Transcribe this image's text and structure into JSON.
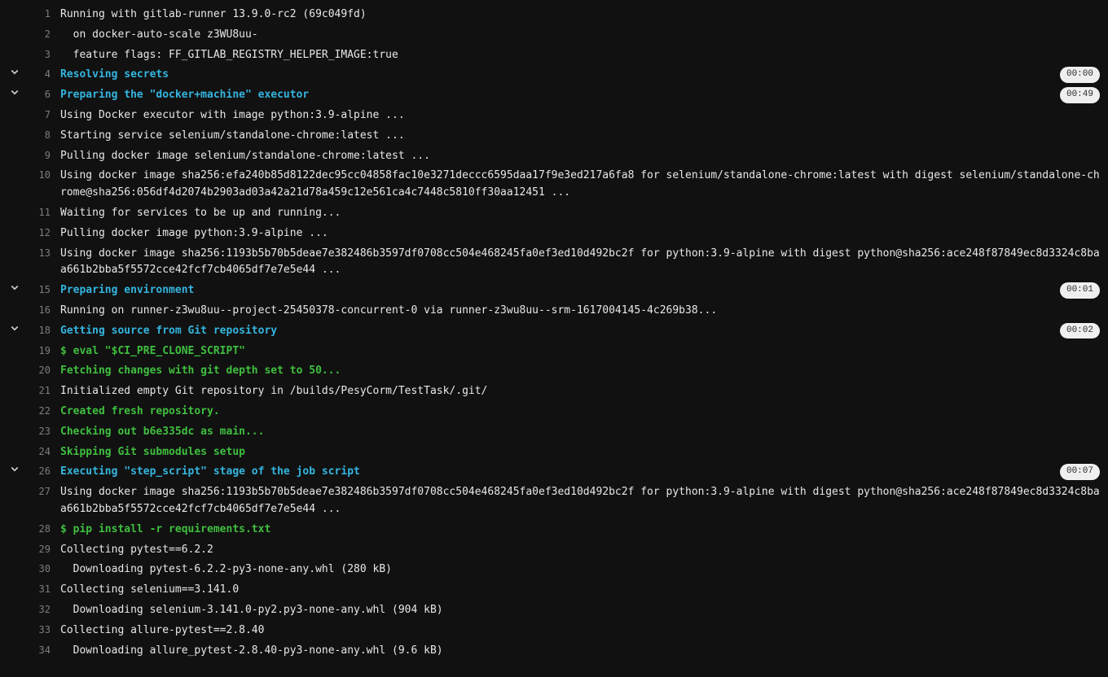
{
  "lines": [
    {
      "n": 1,
      "style": "default",
      "collapsible": false,
      "time": null,
      "text": "Running with gitlab-runner 13.9.0-rc2 (69c049fd)"
    },
    {
      "n": 2,
      "style": "default",
      "collapsible": false,
      "time": null,
      "text": "  on docker-auto-scale z3WU8uu-"
    },
    {
      "n": 3,
      "style": "default",
      "collapsible": false,
      "time": null,
      "text": "  feature flags: FF_GITLAB_REGISTRY_HELPER_IMAGE:true"
    },
    {
      "n": 4,
      "style": "section",
      "collapsible": true,
      "time": "00:00",
      "text": "Resolving secrets"
    },
    {
      "n": 6,
      "style": "section",
      "collapsible": true,
      "time": "00:49",
      "text": "Preparing the \"docker+machine\" executor"
    },
    {
      "n": 7,
      "style": "default",
      "collapsible": false,
      "time": null,
      "text": "Using Docker executor with image python:3.9-alpine ..."
    },
    {
      "n": 8,
      "style": "default",
      "collapsible": false,
      "time": null,
      "text": "Starting service selenium/standalone-chrome:latest ..."
    },
    {
      "n": 9,
      "style": "default",
      "collapsible": false,
      "time": null,
      "text": "Pulling docker image selenium/standalone-chrome:latest ..."
    },
    {
      "n": 10,
      "style": "default",
      "collapsible": false,
      "time": null,
      "text": "Using docker image sha256:efa240b85d8122dec95cc04858fac10e3271deccc6595daa17f9e3ed217a6fa8 for selenium/standalone-chrome:latest with digest selenium/standalone-chrome@sha256:056df4d2074b2903ad03a42a21d78a459c12e561ca4c7448c5810ff30aa12451 ..."
    },
    {
      "n": 11,
      "style": "default",
      "collapsible": false,
      "time": null,
      "text": "Waiting for services to be up and running..."
    },
    {
      "n": 12,
      "style": "default",
      "collapsible": false,
      "time": null,
      "text": "Pulling docker image python:3.9-alpine ..."
    },
    {
      "n": 13,
      "style": "default",
      "collapsible": false,
      "time": null,
      "text": "Using docker image sha256:1193b5b70b5deae7e382486b3597df0708cc504e468245fa0ef3ed10d492bc2f for python:3.9-alpine with digest python@sha256:ace248f87849ec8d3324c8baa661b2bba5f5572cce42fcf7cb4065df7e7e5e44 ..."
    },
    {
      "n": 15,
      "style": "section",
      "collapsible": true,
      "time": "00:01",
      "text": "Preparing environment"
    },
    {
      "n": 16,
      "style": "default",
      "collapsible": false,
      "time": null,
      "text": "Running on runner-z3wu8uu--project-25450378-concurrent-0 via runner-z3wu8uu--srm-1617004145-4c269b38..."
    },
    {
      "n": 18,
      "style": "section",
      "collapsible": true,
      "time": "00:02",
      "text": "Getting source from Git repository"
    },
    {
      "n": 19,
      "style": "green",
      "collapsible": false,
      "time": null,
      "text": "$ eval \"$CI_PRE_CLONE_SCRIPT\""
    },
    {
      "n": 20,
      "style": "green",
      "collapsible": false,
      "time": null,
      "text": "Fetching changes with git depth set to 50..."
    },
    {
      "n": 21,
      "style": "default",
      "collapsible": false,
      "time": null,
      "text": "Initialized empty Git repository in /builds/PesyCorm/TestTask/.git/"
    },
    {
      "n": 22,
      "style": "green",
      "collapsible": false,
      "time": null,
      "text": "Created fresh repository."
    },
    {
      "n": 23,
      "style": "green",
      "collapsible": false,
      "time": null,
      "text": "Checking out b6e335dc as main..."
    },
    {
      "n": 24,
      "style": "green",
      "collapsible": false,
      "time": null,
      "text": "Skipping Git submodules setup"
    },
    {
      "n": 26,
      "style": "section",
      "collapsible": true,
      "time": "00:07",
      "text": "Executing \"step_script\" stage of the job script"
    },
    {
      "n": 27,
      "style": "default",
      "collapsible": false,
      "time": null,
      "text": "Using docker image sha256:1193b5b70b5deae7e382486b3597df0708cc504e468245fa0ef3ed10d492bc2f for python:3.9-alpine with digest python@sha256:ace248f87849ec8d3324c8baa661b2bba5f5572cce42fcf7cb4065df7e7e5e44 ..."
    },
    {
      "n": 28,
      "style": "green",
      "collapsible": false,
      "time": null,
      "text": "$ pip install -r requirements.txt"
    },
    {
      "n": 29,
      "style": "default",
      "collapsible": false,
      "time": null,
      "text": "Collecting pytest==6.2.2"
    },
    {
      "n": 30,
      "style": "default",
      "collapsible": false,
      "time": null,
      "text": "  Downloading pytest-6.2.2-py3-none-any.whl (280 kB)"
    },
    {
      "n": 31,
      "style": "default",
      "collapsible": false,
      "time": null,
      "text": "Collecting selenium==3.141.0"
    },
    {
      "n": 32,
      "style": "default",
      "collapsible": false,
      "time": null,
      "text": "  Downloading selenium-3.141.0-py2.py3-none-any.whl (904 kB)"
    },
    {
      "n": 33,
      "style": "default",
      "collapsible": false,
      "time": null,
      "text": "Collecting allure-pytest==2.8.40"
    },
    {
      "n": 34,
      "style": "default",
      "collapsible": false,
      "time": null,
      "text": "  Downloading allure_pytest-2.8.40-py3-none-any.whl (9.6 kB)"
    }
  ]
}
